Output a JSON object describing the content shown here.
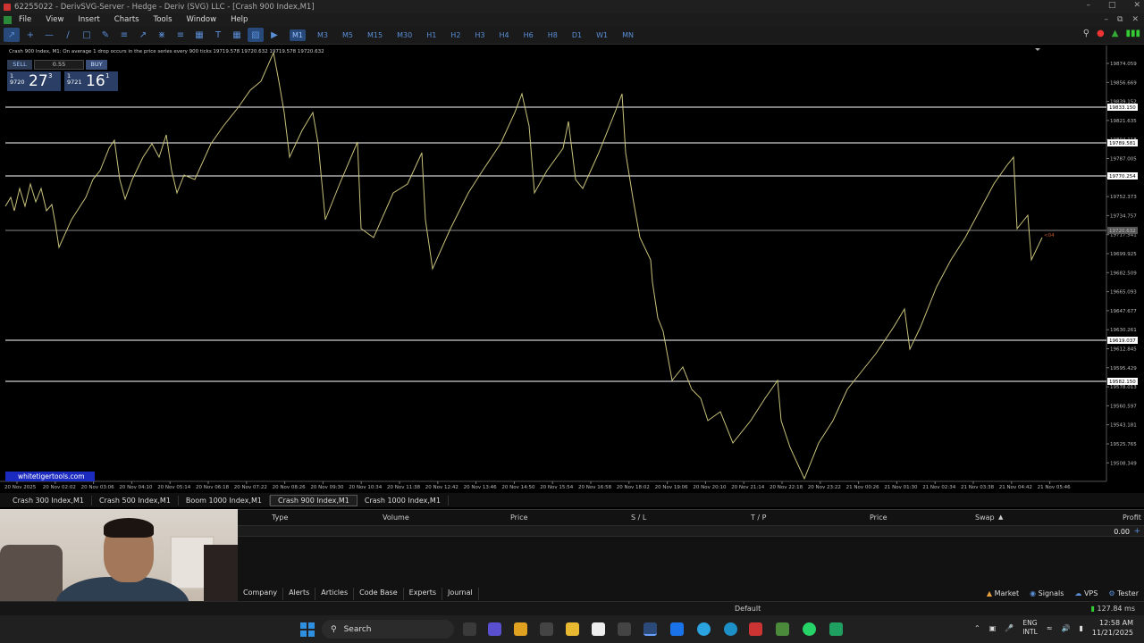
{
  "window": {
    "title": "62255022 - DerivSVG-Server - Hedge - Deriv (SVG) LLC - [Crash 900 Index,M1]"
  },
  "menu": [
    "File",
    "View",
    "Insert",
    "Charts",
    "Tools",
    "Window",
    "Help"
  ],
  "toolbar": {
    "timeframes": [
      "M1",
      "M3",
      "M5",
      "M15",
      "M30",
      "H1",
      "H2",
      "H3",
      "H4",
      "H6",
      "H8",
      "D1",
      "W1",
      "MN"
    ],
    "active_timeframe": "M1"
  },
  "chart": {
    "header": "Crash 900 Index, M1:  On average 1 drop occurs in the price series every 900 ticks  19719.578 19720.632 19719.578 19720.632",
    "trade_panel": {
      "sell_label": "SELL",
      "buy_label": "BUY",
      "lot": "0.55",
      "sell_small": "1\n9720",
      "sell_big": "27",
      "sell_sup": "3",
      "buy_small": "1\n9721",
      "buy_big": "16",
      "buy_sup": "1"
    },
    "watermark": "whitetigertools.com",
    "line_color": "#c8c27a",
    "hline_color": "#ffffff",
    "price_labels": [
      "19874.059",
      "19856.669",
      "19839.152",
      "19821.635",
      "19804.118",
      "19787.005",
      "19769.488",
      "19752.373",
      "19734.757",
      "19717.541",
      "19699.925",
      "19682.509",
      "19665.093",
      "19647.677",
      "19630.261",
      "19612.845",
      "19595.429",
      "19578.013",
      "19560.597",
      "19543.181",
      "19525.765",
      "19508.349"
    ],
    "level_labels": [
      "19833.150",
      "19789.581",
      "19770.254",
      "19720.632",
      "19619.037",
      "19582.150"
    ],
    "current_price": "19720.632",
    "time_labels": [
      "20 Nov 2025",
      "20 Nov 02:02",
      "20 Nov 03:06",
      "20 Nov 04:10",
      "20 Nov 05:14",
      "20 Nov 06:18",
      "20 Nov 07:22",
      "20 Nov 08:26",
      "20 Nov 09:30",
      "20 Nov 10:34",
      "20 Nov 11:38",
      "20 Nov 12:42",
      "20 Nov 13:46",
      "20 Nov 14:50",
      "20 Nov 15:54",
      "20 Nov 16:58",
      "20 Nov 18:02",
      "20 Nov 19:06",
      "20 Nov 20:10",
      "20 Nov 21:14",
      "20 Nov 22:18",
      "20 Nov 23:22",
      "21 Nov 00:26",
      "21 Nov 01:30",
      "21 Nov 02:34",
      "21 Nov 03:38",
      "21 Nov 04:42",
      "21 Nov 05:46"
    ],
    "countdown": "<04"
  },
  "chart_tabs": [
    "Crash 300 Index,M1",
    "Crash 500 Index,M1",
    "Boom 1000 Index,M1",
    "Crash 900 Index,M1",
    "Crash 1000 Index,M1"
  ],
  "active_chart_tab": "Crash 900 Index,M1",
  "terminal": {
    "columns": [
      "Type",
      "Volume",
      "Price",
      "S / L",
      "T / P",
      "Price",
      "Swap",
      "Profit"
    ],
    "balance_value": "0.00",
    "tabs": [
      "Company",
      "Alerts",
      "Articles",
      "Code Base",
      "Experts",
      "Journal"
    ],
    "right_items": [
      "Market",
      "Signals",
      "VPS",
      "Tester"
    ]
  },
  "status": {
    "profile": "Default",
    "ping": "127.84 ms"
  },
  "taskbar": {
    "search_label": "Search",
    "lang_top": "ENG",
    "lang_bottom": "INTL",
    "time": "12:58 AM",
    "date": "11/21/2025"
  }
}
